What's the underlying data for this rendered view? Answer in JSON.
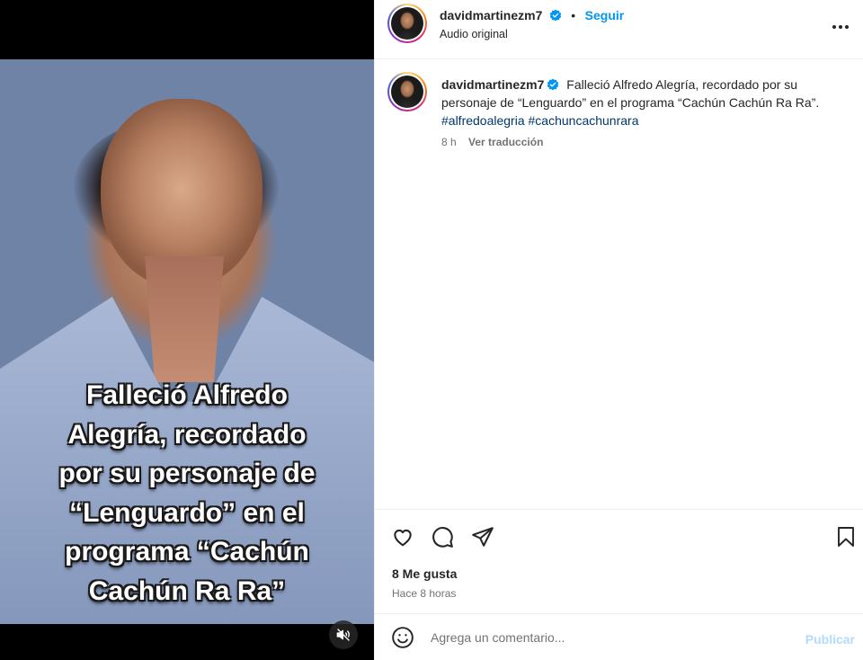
{
  "media": {
    "overlay_lines": [
      "Falleció Alfredo",
      "Alegría, recordado",
      "por su personaje de",
      "“Lenguardo” en el",
      "programa “Cachún",
      "Cachún Ra Ra”"
    ],
    "mute_icon": "speaker-muted-icon"
  },
  "header": {
    "username": "davidmartinezm7",
    "separator": "•",
    "follow_label": "Seguir",
    "subtitle": "Audio original",
    "more_icon": "more-horizontal-icon"
  },
  "caption": {
    "username": "davidmartinezm7",
    "text": "Falleció Alfredo Alegría, recordado por su personaje de “Lenguardo” en el programa “Cachún Cachún Ra Ra”.",
    "hashtags": [
      "#alfredoalegria",
      "#cachuncachunrara"
    ],
    "time": "8 h",
    "translate_label": "Ver traducción"
  },
  "actions": {
    "likes": "8 Me gusta",
    "time_ago": "Hace 8 horas",
    "icons": [
      "heart-icon",
      "comment-icon",
      "share-icon",
      "bookmark-icon"
    ]
  },
  "comment": {
    "placeholder": "Agrega un comentario...",
    "publish_label": "Publicar",
    "emoji_icon": "emoji-icon"
  },
  "colors": {
    "accent": "#0095f6",
    "verified": "#0095f6",
    "hashtag": "#00376b",
    "muted_text": "#737373",
    "publish_disabled": "#b3dbff"
  }
}
